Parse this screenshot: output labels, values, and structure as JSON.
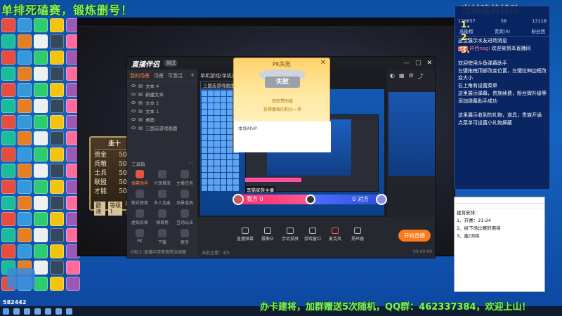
{
  "overlay": {
    "top_left_banner": "单排死磕赛，锻炼删号！",
    "top_right_banner": "当前建将排队：",
    "queue_numbers": [
      "1.",
      "2.",
      "3."
    ],
    "bottom_banner": "办卡建将，加群赠送5次随机，QQ群：462337384，欢迎上山！",
    "room_id": "582442"
  },
  "game_card": {
    "title": "圭十",
    "rows": [
      {
        "label": "资金",
        "value": "5000"
      },
      {
        "label": "兵粮",
        "value": "5000"
      },
      {
        "label": "士兵",
        "value": "5000"
      },
      {
        "label": "联盟",
        "value": "5000"
      },
      {
        "label": "才能",
        "value": "5000"
      }
    ],
    "fight_label": "戳通",
    "fight_sub": "等级1",
    "cost_label": "成本",
    "cost_value": "✕0"
  },
  "app": {
    "logo": "直播伴侣",
    "badge": "测试",
    "tabs": [
      "我的场景",
      "场景",
      "可激活"
    ],
    "layers": [
      "文本 4",
      "新建文本",
      "文本 2",
      "文本 1",
      "桌面",
      "三国志游戏画面"
    ],
    "tools_title": "工具箱",
    "tools": [
      {
        "label": "弹幕助手",
        "hot": true
      },
      {
        "label": "分享推流",
        "hot": false
      },
      {
        "label": "主播任务",
        "hot": false
      },
      {
        "label": "粉丝答案",
        "hot": false
      },
      {
        "label": "多人连麦",
        "hot": false
      },
      {
        "label": "场景道具",
        "hot": false
      },
      {
        "label": "虚拟形象",
        "hot": false
      },
      {
        "label": "弹幕秀",
        "hot": false
      },
      {
        "label": "互动玩法",
        "hot": false
      },
      {
        "label": "PK",
        "hot": false
      },
      {
        "label": "下载",
        "hot": false
      },
      {
        "label": "更多",
        "hot": false
      }
    ],
    "footer": "小贴士:直播中请使用简洁画面",
    "workspace_tab": "单机游戏(单机)",
    "scene_button": "三国志游戏画面",
    "pk": {
      "left_name": "黑猫家族主播",
      "left_text": "我方 0",
      "right_text": "0 对方"
    },
    "toolbar": [
      {
        "label": "直播弹幕",
        "icon": "danmaku-icon"
      },
      {
        "label": "摄像头",
        "icon": "camera-icon"
      },
      {
        "label": "手机投屏",
        "icon": "phone-icon"
      },
      {
        "label": "游戏窗口",
        "icon": "window-icon"
      },
      {
        "label": "麦克风",
        "icon": "mic-icon"
      },
      {
        "label": "扬声器",
        "icon": "speaker-icon"
      }
    ],
    "start_live": "开始直播",
    "status_left": "当前主播：4/5",
    "status_right": "00:00:00"
  },
  "pk_popup": {
    "title": "PK失败",
    "close": "✕",
    "result": "失败",
    "sub1": "获取赞助值",
    "sub2": "获得魔兽的积分一项",
    "body": "本场MVP"
  },
  "chat": {
    "stats": [
      "128657",
      "58",
      "13118"
    ],
    "tabs": [
      "高能榜",
      "贵宾(4)",
      "粉丝团"
    ],
    "messages": [
      {
        "tag": "",
        "nick": "",
        "text": "这里展示水友进场消息"
      },
      {
        "tag": "主播",
        "nick": "碎西nagi",
        "text": "欢迎来到本直播间"
      },
      {
        "tag": "",
        "nick": "",
        "text": "欢迎使用斗鱼弹幕助手"
      },
      {
        "tag": "",
        "nick": "",
        "text": "左键拖拽顶部改变位置，左键拉伸边框改变大小"
      },
      {
        "tag": "",
        "nick": "",
        "text": "右上角有设置菜单"
      },
      {
        "tag": "",
        "nick": "",
        "text": "这里展示弹幕，贵族续费，粉丝牌升级等"
      },
      {
        "tag": "",
        "nick": "",
        "text": "添加弹幕助手成功"
      },
      {
        "tag": "",
        "nick": "",
        "text": "这里展示收到的礼物，道具，贵族开通"
      },
      {
        "tag": "",
        "nick": "",
        "text": "点菜单可设置小礼物屏蔽"
      }
    ]
  },
  "notepad": {
    "lines": [
      "建将安排：",
      "1、开赛：21-24",
      "2、给下场比赛的用将",
      "3、建/词将"
    ]
  }
}
